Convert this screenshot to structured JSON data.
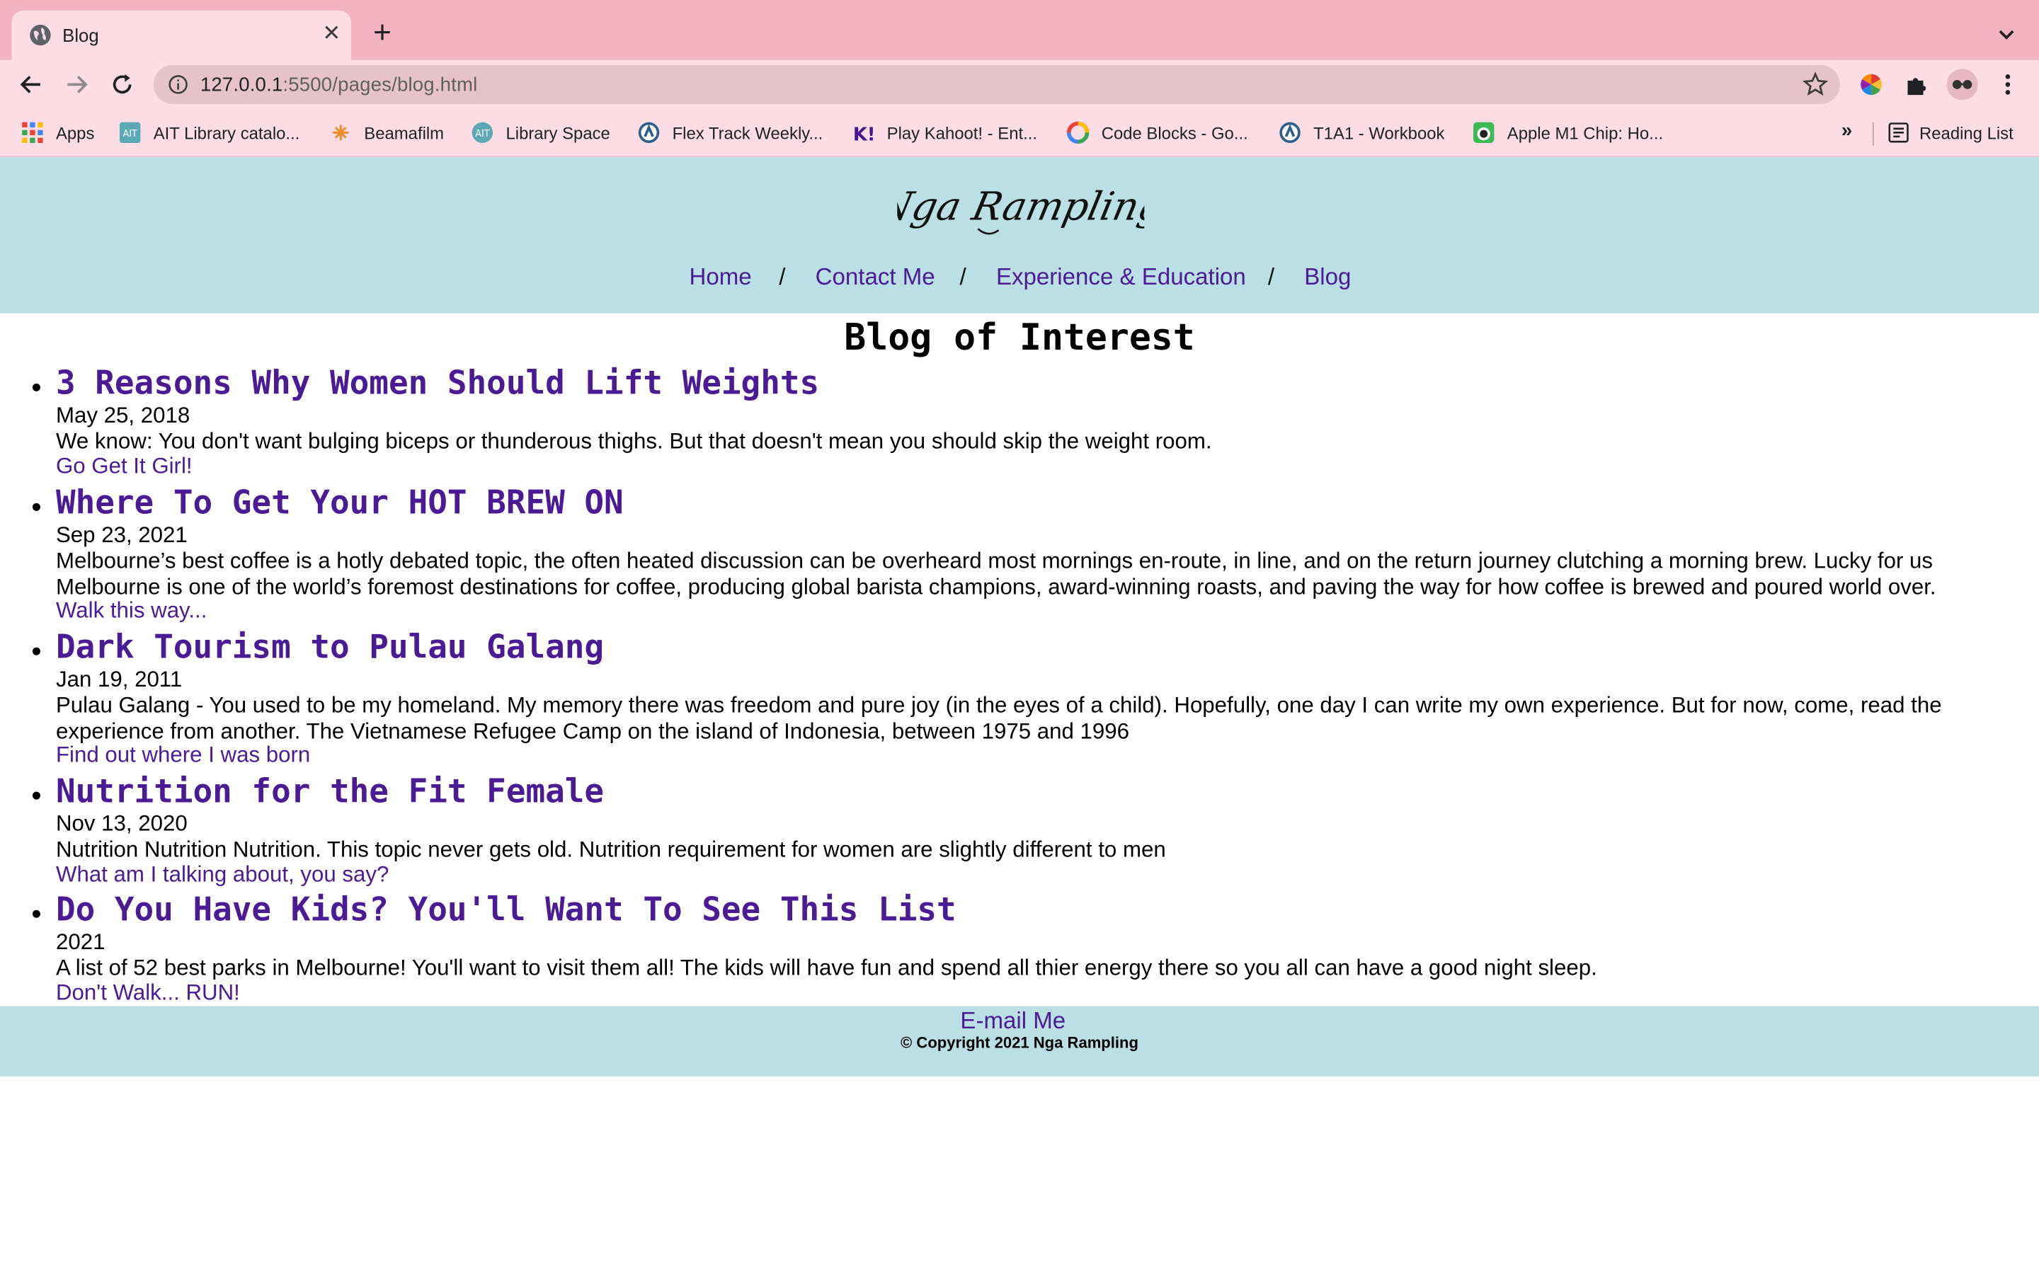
{
  "browser": {
    "tab_title": "Blog",
    "tab_close": "✕",
    "new_tab": "+",
    "url_host": "127.0.0.1",
    "url_rest": ":5500/pages/blog.html",
    "bookmarks": [
      {
        "label": "Apps",
        "icon": "apps-grid-icon"
      },
      {
        "label": "AIT Library catalo...",
        "icon": "ait-icon"
      },
      {
        "label": "Beamafilm",
        "icon": "beamafilm-icon"
      },
      {
        "label": "Library Space",
        "icon": "library-space-icon"
      },
      {
        "label": "Flex Track Weekly...",
        "icon": "flex-track-icon"
      },
      {
        "label": "Play Kahoot! - Ent...",
        "icon": "kahoot-icon"
      },
      {
        "label": "Code Blocks - Go...",
        "icon": "google-icon"
      },
      {
        "label": "T1A1 - Workbook",
        "icon": "workbook-icon"
      },
      {
        "label": "Apple M1 Chip: Ho...",
        "icon": "apple-m1-icon"
      }
    ],
    "bookmarks_more": "»",
    "reading_list": "Reading List"
  },
  "site": {
    "logo_text": "Nga Rampling",
    "nav": {
      "home": "Home",
      "contact": "Contact Me",
      "experience": "Experience & Education",
      "blog": "Blog",
      "separator": "/"
    },
    "heading": "Blog of Interest",
    "posts": [
      {
        "title": "3 Reasons Why Women Should Lift Weights",
        "date": "May 25, 2018",
        "excerpt": "We know: You don't want bulging biceps or thunderous thighs. But that doesn't mean you should skip the weight room.",
        "link": "Go Get It Girl!"
      },
      {
        "title": "Where To Get Your HOT BREW ON",
        "date": "Sep 23, 2021",
        "excerpt": "Melbourne’s best coffee is a hotly debated topic, the often heated discussion can be overheard most mornings en-route, in line, and on the return journey clutching a morning brew. Lucky for us Melbourne is one of the world’s foremost destinations for coffee, producing global barista champions, award-winning roasts, and paving the way for how coffee is brewed and poured world over.",
        "link": "Walk this way..."
      },
      {
        "title": "Dark Tourism to Pulau Galang",
        "date": "Jan 19, 2011",
        "excerpt": "Pulau Galang - You used to be my homeland. My memory there was freedom and pure joy (in the eyes of a child). Hopefully, one day I can write my own experience. But for now, come, read the experience from another. The Vietnamese Refugee Camp on the island of Indonesia, between 1975 and 1996",
        "link": "Find out where I was born"
      },
      {
        "title": "Nutrition for the Fit Female",
        "date": "Nov 13, 2020",
        "excerpt": "Nutrition Nutrition Nutrition. This topic never gets old. Nutrition requirement for women are slightly different to men",
        "link": "What am I talking about, you say?"
      },
      {
        "title": "Do You Have Kids? You'll Want To See This List",
        "date": "2021",
        "excerpt": "A list of 52 best parks in Melbourne! You'll want to visit them all! The kids will have fun and spend all thier energy there so you all can have a good night sleep.",
        "link": "Don't Walk... RUN!"
      }
    ],
    "footer": {
      "email": "E-mail Me",
      "copyright": "© Copyright 2021 Nga Rampling"
    }
  },
  "colors": {
    "tabstrip": "#f4b3c2",
    "toolbar": "#fcdde5",
    "header_bg": "#badfe5",
    "link": "#4b1b96"
  }
}
